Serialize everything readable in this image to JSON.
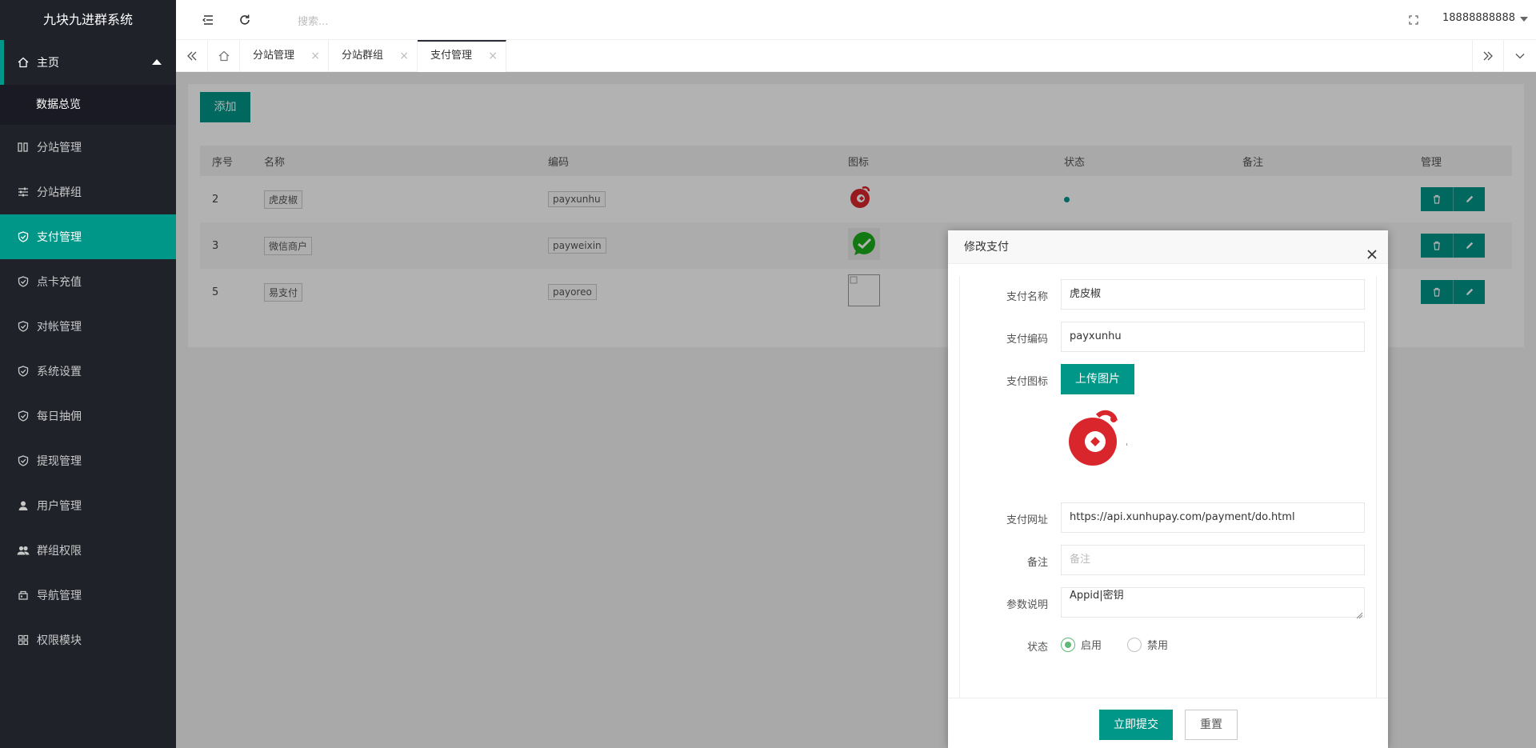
{
  "app": {
    "title": "九块九进群系统"
  },
  "sidebar": {
    "items": [
      {
        "label": "主页",
        "icon": "home-icon"
      },
      {
        "label": "数据总览"
      },
      {
        "label": "分站管理",
        "icon": "columns-icon"
      },
      {
        "label": "分站群组",
        "icon": "sliders-icon"
      },
      {
        "label": "支付管理",
        "icon": "shield-check-icon"
      },
      {
        "label": "点卡充值",
        "icon": "shield-check-icon"
      },
      {
        "label": "对帐管理",
        "icon": "shield-check-icon"
      },
      {
        "label": "系统设置",
        "icon": "shield-check-icon"
      },
      {
        "label": "每日抽佣",
        "icon": "shield-check-icon"
      },
      {
        "label": "提现管理",
        "icon": "shield-check-icon"
      },
      {
        "label": "用户管理",
        "icon": "user-icon"
      },
      {
        "label": "群组权限",
        "icon": "users-icon"
      },
      {
        "label": "导航管理",
        "icon": "nav-icon"
      },
      {
        "label": "权限模块",
        "icon": "grid-icon"
      }
    ]
  },
  "header": {
    "search_placeholder": "搜索...",
    "username": "18888888888"
  },
  "tabs": [
    {
      "label": "分站管理"
    },
    {
      "label": "分站群组"
    },
    {
      "label": "支付管理"
    }
  ],
  "main": {
    "add_label": "添加",
    "columns": [
      "序号",
      "名称",
      "编码",
      "图标",
      "状态",
      "备注",
      "管理"
    ],
    "rows": [
      {
        "id": "2",
        "name": "虎皮椒",
        "code": "payxunhu",
        "icon": "xunhu-logo-icon",
        "status": "enabled-dot"
      },
      {
        "id": "3",
        "name": "微信商户",
        "code": "payweixin",
        "icon": "wechat-logo-icon",
        "status": ""
      },
      {
        "id": "5",
        "name": "易支付",
        "code": "payoreo",
        "icon": "broken-image-icon",
        "status": ""
      }
    ]
  },
  "modal": {
    "title": "修改支付",
    "fields": {
      "name_label": "支付名称",
      "name_value": "虎皮椒",
      "code_label": "支付编码",
      "code_value": "payxunhu",
      "icon_label": "支付图标",
      "upload_label": "上传图片",
      "url_label": "支付网址",
      "url_value": "https://api.xunhupay.com/payment/do.html",
      "note_label": "备注",
      "note_placeholder": "备注",
      "params_label": "参数说明",
      "params_value": "Appid|密钥",
      "status_label": "状态",
      "status_on": "启用",
      "status_off": "禁用"
    },
    "submit_label": "立即提交",
    "reset_label": "重置"
  },
  "colors": {
    "accent": "#009688",
    "sidebar_bg": "#20222a",
    "radio_on": "#5fb878"
  }
}
